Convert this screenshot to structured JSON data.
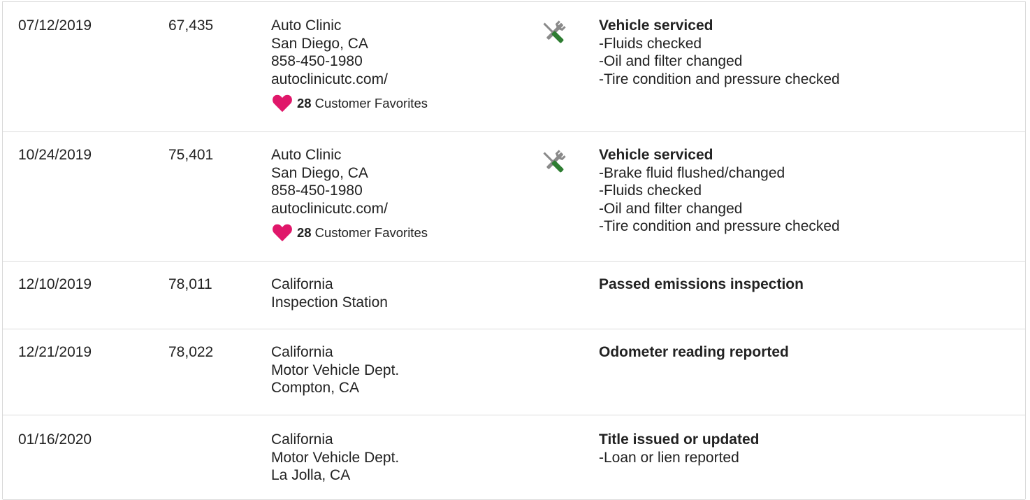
{
  "rows": [
    {
      "date": "07/12/2019",
      "mileage": "67,435",
      "source": [
        "Auto Clinic",
        "San Diego, CA",
        "858-450-1980",
        "autoclinicutc.com/"
      ],
      "favorites": {
        "count": "28",
        "label": "Customer Favorites"
      },
      "icon": "service-tools-icon",
      "title": "Vehicle serviced",
      "details": [
        "-Fluids checked",
        "-Oil and filter changed",
        "-Tire condition and pressure checked"
      ]
    },
    {
      "date": "10/24/2019",
      "mileage": "75,401",
      "source": [
        "Auto Clinic",
        "San Diego, CA",
        "858-450-1980",
        "autoclinicutc.com/"
      ],
      "favorites": {
        "count": "28",
        "label": "Customer Favorites"
      },
      "icon": "service-tools-icon",
      "title": "Vehicle serviced",
      "details": [
        "-Brake fluid flushed/changed",
        "-Fluids checked",
        "-Oil and filter changed",
        "-Tire condition and pressure checked"
      ]
    },
    {
      "date": "12/10/2019",
      "mileage": "78,011",
      "source": [
        "California",
        "Inspection Station"
      ],
      "title": "Passed emissions inspection",
      "details": []
    },
    {
      "date": "12/21/2019",
      "mileage": "78,022",
      "source": [
        "California",
        "Motor Vehicle Dept.",
        "Compton, CA"
      ],
      "title": "Odometer reading reported",
      "details": []
    },
    {
      "date": "01/16/2020",
      "mileage": "",
      "source": [
        "California",
        "Motor Vehicle Dept.",
        "La Jolla, CA"
      ],
      "title": "Title issued or updated",
      "details": [
        "-Loan or lien reported"
      ]
    }
  ],
  "colors": {
    "heart": "#e0176a",
    "tool_green": "#2e7d32",
    "tool_gray": "#8a8a8a",
    "border": "#dcdcdc"
  }
}
